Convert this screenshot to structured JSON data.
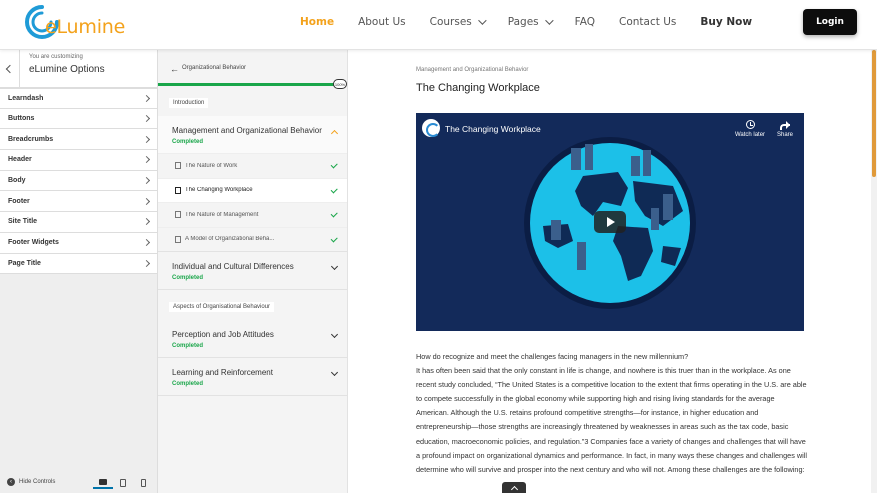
{
  "header": {
    "logo_text": "eLumine",
    "nav": [
      {
        "label": "Home",
        "dropdown": false
      },
      {
        "label": "About Us",
        "dropdown": false
      },
      {
        "label": "Courses",
        "dropdown": true
      },
      {
        "label": "Pages",
        "dropdown": true
      },
      {
        "label": "FAQ",
        "dropdown": false
      },
      {
        "label": "Contact Us",
        "dropdown": false
      },
      {
        "label": "Buy Now",
        "dropdown": false
      }
    ],
    "login_label": "Login",
    "accent_color": "#f3a21c"
  },
  "customizer": {
    "subtitle": "You are customizing",
    "title": "eLumine Options",
    "items": [
      "Learndash",
      "Buttons",
      "Breadcrumbs",
      "Header",
      "Body",
      "Footer",
      "Site Title",
      "Footer Widgets",
      "Page Title"
    ],
    "hide_controls": "Hide Controls",
    "devices": [
      "desktop-icon",
      "tablet-icon",
      "mobile-icon"
    ]
  },
  "course": {
    "name": "Organizational Behavior",
    "progress_percent": 100,
    "progress_label": "100%",
    "sections": [
      {
        "label": "Introduction",
        "lessons": [
          {
            "title": "Management and Organizational Behavior",
            "status": "Completed",
            "expanded": true,
            "topics": [
              {
                "label": "The Nature of Work",
                "active": false
              },
              {
                "label": "The Changing Workplace",
                "active": true
              },
              {
                "label": "The Nature of Management",
                "active": false
              },
              {
                "label": "A Model of Organizational Beha...",
                "active": false
              }
            ]
          },
          {
            "title": "Individual and Cultural Differences",
            "status": "Completed",
            "expanded": false
          }
        ]
      },
      {
        "label": "Aspects of Organisational Behaviour",
        "lessons": [
          {
            "title": "Perception and Job Attitudes",
            "status": "Completed",
            "expanded": false
          },
          {
            "title": "Learning and Reinforcement",
            "status": "Completed",
            "expanded": false
          }
        ]
      }
    ],
    "completed_color": "#1aa64a"
  },
  "main": {
    "breadcrumb": "Management and Organizational Behavior",
    "title": "The Changing Workplace",
    "video": {
      "title": "The Changing Workplace",
      "watch_later": "Watch later",
      "share": "Share"
    },
    "paragraphs": [
      "How do recognize and meet the challenges facing managers in the new millennium?",
      "It has often been said that the only constant in life is change, and nowhere is this truer than in the workplace. As one recent study concluded, “The United States is a competitive location to the extent that firms operating in the U.S. are able to compete successfully in the global economy while supporting high and rising living standards for the average American. Although the U.S. retains profound competitive strengths—for instance, in higher education and entrepreneurship—those strengths are increasingly threatened by weaknesses in areas such as the tax code, basic education, macroeconomic policies, and regulation.”3 Companies face a variety of changes and challenges that will have a profound impact on organizational dynamics and performance. In fact, in many ways these changes and challenges will determine who will survive and prosper into the next century and who will not. Among these challenges are the following:"
    ]
  }
}
